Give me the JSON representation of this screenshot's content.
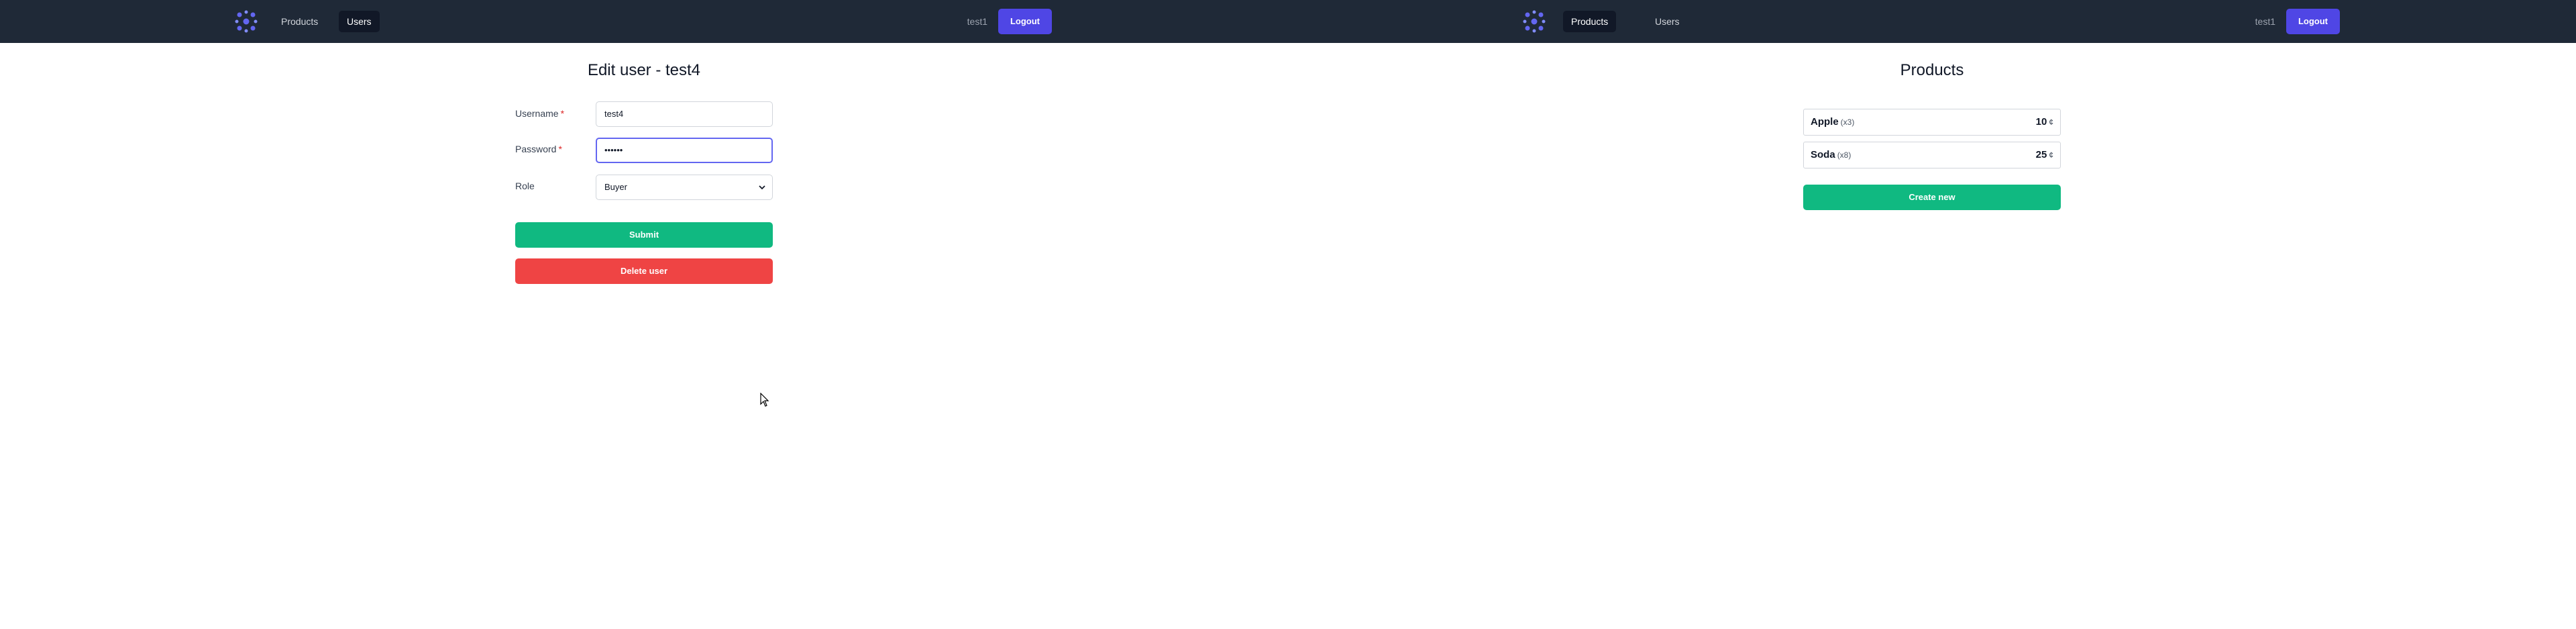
{
  "left_window": {
    "nav": {
      "products_label": "Products",
      "users_label": "Users",
      "username": "test1",
      "logout_label": "Logout"
    },
    "page_title": "Edit user - test4",
    "form": {
      "username_label": "Username",
      "username_value": "test4",
      "password_label": "Password",
      "password_value": "••••••",
      "role_label": "Role",
      "role_value": "Buyer",
      "required_marker": "*",
      "submit_label": "Submit",
      "delete_label": "Delete user"
    }
  },
  "right_window": {
    "nav": {
      "products_label": "Products",
      "users_label": "Users",
      "username": "test1",
      "logout_label": "Logout"
    },
    "page_title": "Products",
    "products": [
      {
        "name": "Apple",
        "qty": "(x3)",
        "price": "10",
        "currency": "¢"
      },
      {
        "name": "Soda",
        "qty": "(x8)",
        "price": "25",
        "currency": "¢"
      }
    ],
    "create_label": "Create new"
  },
  "colors": {
    "navbar": "#1f2937",
    "accent": "#4f46e5",
    "success": "#10b981",
    "danger": "#ef4444"
  },
  "icons": [
    "logo-icon",
    "chevron-down-icon",
    "mouse-cursor-icon"
  ]
}
